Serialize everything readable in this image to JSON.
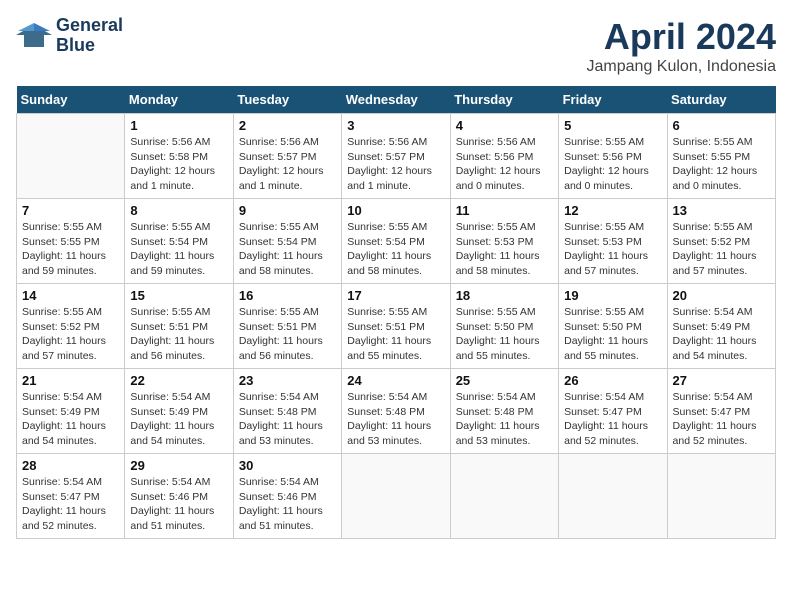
{
  "header": {
    "logo_line1": "General",
    "logo_line2": "Blue",
    "month_year": "April 2024",
    "location": "Jampang Kulon, Indonesia"
  },
  "weekdays": [
    "Sunday",
    "Monday",
    "Tuesday",
    "Wednesday",
    "Thursday",
    "Friday",
    "Saturday"
  ],
  "weeks": [
    [
      {
        "day": "",
        "info": ""
      },
      {
        "day": "1",
        "info": "Sunrise: 5:56 AM\nSunset: 5:58 PM\nDaylight: 12 hours\nand 1 minute."
      },
      {
        "day": "2",
        "info": "Sunrise: 5:56 AM\nSunset: 5:57 PM\nDaylight: 12 hours\nand 1 minute."
      },
      {
        "day": "3",
        "info": "Sunrise: 5:56 AM\nSunset: 5:57 PM\nDaylight: 12 hours\nand 1 minute."
      },
      {
        "day": "4",
        "info": "Sunrise: 5:56 AM\nSunset: 5:56 PM\nDaylight: 12 hours\nand 0 minutes."
      },
      {
        "day": "5",
        "info": "Sunrise: 5:55 AM\nSunset: 5:56 PM\nDaylight: 12 hours\nand 0 minutes."
      },
      {
        "day": "6",
        "info": "Sunrise: 5:55 AM\nSunset: 5:55 PM\nDaylight: 12 hours\nand 0 minutes."
      }
    ],
    [
      {
        "day": "7",
        "info": "Sunrise: 5:55 AM\nSunset: 5:55 PM\nDaylight: 11 hours\nand 59 minutes."
      },
      {
        "day": "8",
        "info": "Sunrise: 5:55 AM\nSunset: 5:54 PM\nDaylight: 11 hours\nand 59 minutes."
      },
      {
        "day": "9",
        "info": "Sunrise: 5:55 AM\nSunset: 5:54 PM\nDaylight: 11 hours\nand 58 minutes."
      },
      {
        "day": "10",
        "info": "Sunrise: 5:55 AM\nSunset: 5:54 PM\nDaylight: 11 hours\nand 58 minutes."
      },
      {
        "day": "11",
        "info": "Sunrise: 5:55 AM\nSunset: 5:53 PM\nDaylight: 11 hours\nand 58 minutes."
      },
      {
        "day": "12",
        "info": "Sunrise: 5:55 AM\nSunset: 5:53 PM\nDaylight: 11 hours\nand 57 minutes."
      },
      {
        "day": "13",
        "info": "Sunrise: 5:55 AM\nSunset: 5:52 PM\nDaylight: 11 hours\nand 57 minutes."
      }
    ],
    [
      {
        "day": "14",
        "info": "Sunrise: 5:55 AM\nSunset: 5:52 PM\nDaylight: 11 hours\nand 57 minutes."
      },
      {
        "day": "15",
        "info": "Sunrise: 5:55 AM\nSunset: 5:51 PM\nDaylight: 11 hours\nand 56 minutes."
      },
      {
        "day": "16",
        "info": "Sunrise: 5:55 AM\nSunset: 5:51 PM\nDaylight: 11 hours\nand 56 minutes."
      },
      {
        "day": "17",
        "info": "Sunrise: 5:55 AM\nSunset: 5:51 PM\nDaylight: 11 hours\nand 55 minutes."
      },
      {
        "day": "18",
        "info": "Sunrise: 5:55 AM\nSunset: 5:50 PM\nDaylight: 11 hours\nand 55 minutes."
      },
      {
        "day": "19",
        "info": "Sunrise: 5:55 AM\nSunset: 5:50 PM\nDaylight: 11 hours\nand 55 minutes."
      },
      {
        "day": "20",
        "info": "Sunrise: 5:54 AM\nSunset: 5:49 PM\nDaylight: 11 hours\nand 54 minutes."
      }
    ],
    [
      {
        "day": "21",
        "info": "Sunrise: 5:54 AM\nSunset: 5:49 PM\nDaylight: 11 hours\nand 54 minutes."
      },
      {
        "day": "22",
        "info": "Sunrise: 5:54 AM\nSunset: 5:49 PM\nDaylight: 11 hours\nand 54 minutes."
      },
      {
        "day": "23",
        "info": "Sunrise: 5:54 AM\nSunset: 5:48 PM\nDaylight: 11 hours\nand 53 minutes."
      },
      {
        "day": "24",
        "info": "Sunrise: 5:54 AM\nSunset: 5:48 PM\nDaylight: 11 hours\nand 53 minutes."
      },
      {
        "day": "25",
        "info": "Sunrise: 5:54 AM\nSunset: 5:48 PM\nDaylight: 11 hours\nand 53 minutes."
      },
      {
        "day": "26",
        "info": "Sunrise: 5:54 AM\nSunset: 5:47 PM\nDaylight: 11 hours\nand 52 minutes."
      },
      {
        "day": "27",
        "info": "Sunrise: 5:54 AM\nSunset: 5:47 PM\nDaylight: 11 hours\nand 52 minutes."
      }
    ],
    [
      {
        "day": "28",
        "info": "Sunrise: 5:54 AM\nSunset: 5:47 PM\nDaylight: 11 hours\nand 52 minutes."
      },
      {
        "day": "29",
        "info": "Sunrise: 5:54 AM\nSunset: 5:46 PM\nDaylight: 11 hours\nand 51 minutes."
      },
      {
        "day": "30",
        "info": "Sunrise: 5:54 AM\nSunset: 5:46 PM\nDaylight: 11 hours\nand 51 minutes."
      },
      {
        "day": "",
        "info": ""
      },
      {
        "day": "",
        "info": ""
      },
      {
        "day": "",
        "info": ""
      },
      {
        "day": "",
        "info": ""
      }
    ]
  ]
}
